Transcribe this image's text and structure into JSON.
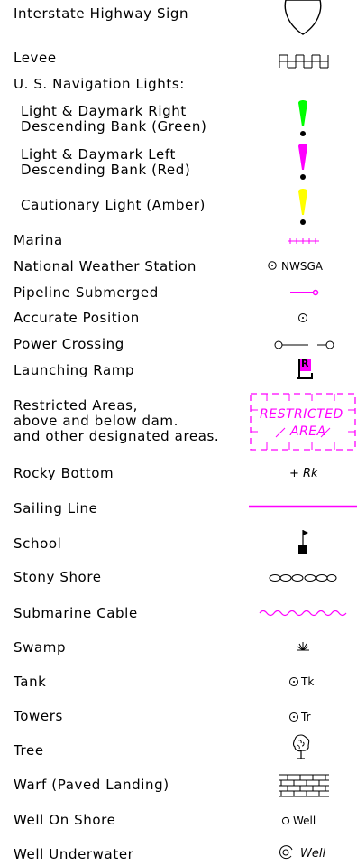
{
  "legend": {
    "interstate": "Interstate Highway Sign",
    "levee": "Levee",
    "nav_lights": "U. S. Navigation Lights:",
    "light_right_1": "Light & Daymark Right",
    "light_right_2": "Descending Bank (Green)",
    "light_left_1": "Light & Daymark Left",
    "light_left_2": "Descending Bank (Red)",
    "cautionary": "Cautionary Light (Amber)",
    "marina": "Marina",
    "weather": "National Weather Station",
    "weather_symbol": "NWSGA",
    "pipeline": "Pipeline Submerged",
    "accurate": "Accurate Position",
    "power": "Power Crossing",
    "ramp": "Launching Ramp",
    "ramp_letter": "R",
    "restricted_1": "Restricted Areas,",
    "restricted_2": "above and below dam.",
    "restricted_3": "and other designated areas.",
    "restricted_word": "RESTRICTED",
    "area_word": "AREA",
    "rocky": "Rocky Bottom",
    "rocky_symbol": "+ Rk",
    "sailing": "Sailing Line",
    "school": "School",
    "stony": "Stony Shore",
    "cable": "Submarine Cable",
    "swamp": "Swamp",
    "tank": "Tank",
    "tank_symbol": "Tk",
    "towers": "Towers",
    "towers_symbol": "Tr",
    "tree": "Tree",
    "warf": "Warf (Paved Landing)",
    "well_shore": "Well On Shore",
    "well_shore_symbol": "Well",
    "well_underwater": "Well Underwater",
    "well_underwater_symbol": "Well"
  },
  "colors": {
    "green": "#00ff00",
    "magenta": "#ff00ff",
    "yellow": "#ffff00",
    "black": "#000000"
  }
}
